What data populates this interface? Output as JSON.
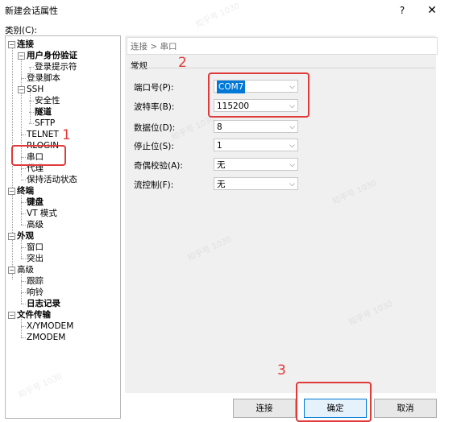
{
  "window": {
    "title": "新建会话属性",
    "help": "?",
    "close": "✕"
  },
  "category_label": "类别(C):",
  "tree": [
    {
      "label": "连接",
      "bold": true
    },
    {
      "label": "用户身份验证",
      "bold": true
    },
    {
      "label": "登录提示符",
      "bold": false
    },
    {
      "label": "登录脚本",
      "bold": false
    },
    {
      "label": "SSH",
      "bold": false
    },
    {
      "label": "安全性",
      "bold": false
    },
    {
      "label": "隧道",
      "bold": true
    },
    {
      "label": "SFTP",
      "bold": false
    },
    {
      "label": "TELNET",
      "bold": false
    },
    {
      "label": "RLOGIN",
      "bold": false
    },
    {
      "label": "串口",
      "bold": false
    },
    {
      "label": "代理",
      "bold": false
    },
    {
      "label": "保持活动状态",
      "bold": false
    },
    {
      "label": "终端",
      "bold": true
    },
    {
      "label": "键盘",
      "bold": true
    },
    {
      "label": "VT 模式",
      "bold": false
    },
    {
      "label": "高级",
      "bold": false
    },
    {
      "label": "外观",
      "bold": true
    },
    {
      "label": "窗口",
      "bold": false
    },
    {
      "label": "突出",
      "bold": false
    },
    {
      "label": "高级",
      "bold": false
    },
    {
      "label": "跟踪",
      "bold": false
    },
    {
      "label": "响铃",
      "bold": false
    },
    {
      "label": "日志记录",
      "bold": true
    },
    {
      "label": "文件传输",
      "bold": true
    },
    {
      "label": "X/YMODEM",
      "bold": false
    },
    {
      "label": "ZMODEM",
      "bold": false
    }
  ],
  "breadcrumb": "连接 > 串口",
  "section_title": "常规",
  "fields": [
    {
      "label": "端口号(P):",
      "value": "COM7"
    },
    {
      "label": "波特率(B):",
      "value": "115200"
    },
    {
      "label": "数据位(D):",
      "value": "8"
    },
    {
      "label": "停止位(S):",
      "value": "1"
    },
    {
      "label": "奇偶校验(A):",
      "value": "无"
    },
    {
      "label": "流控制(F):",
      "value": "无"
    }
  ],
  "buttons": {
    "connect": "连接",
    "ok": "确定",
    "cancel": "取消"
  },
  "annotations": {
    "one": "1",
    "two": "2",
    "three": "3",
    "color": "#e03a3a"
  },
  "watermark": "知乎号 1030"
}
